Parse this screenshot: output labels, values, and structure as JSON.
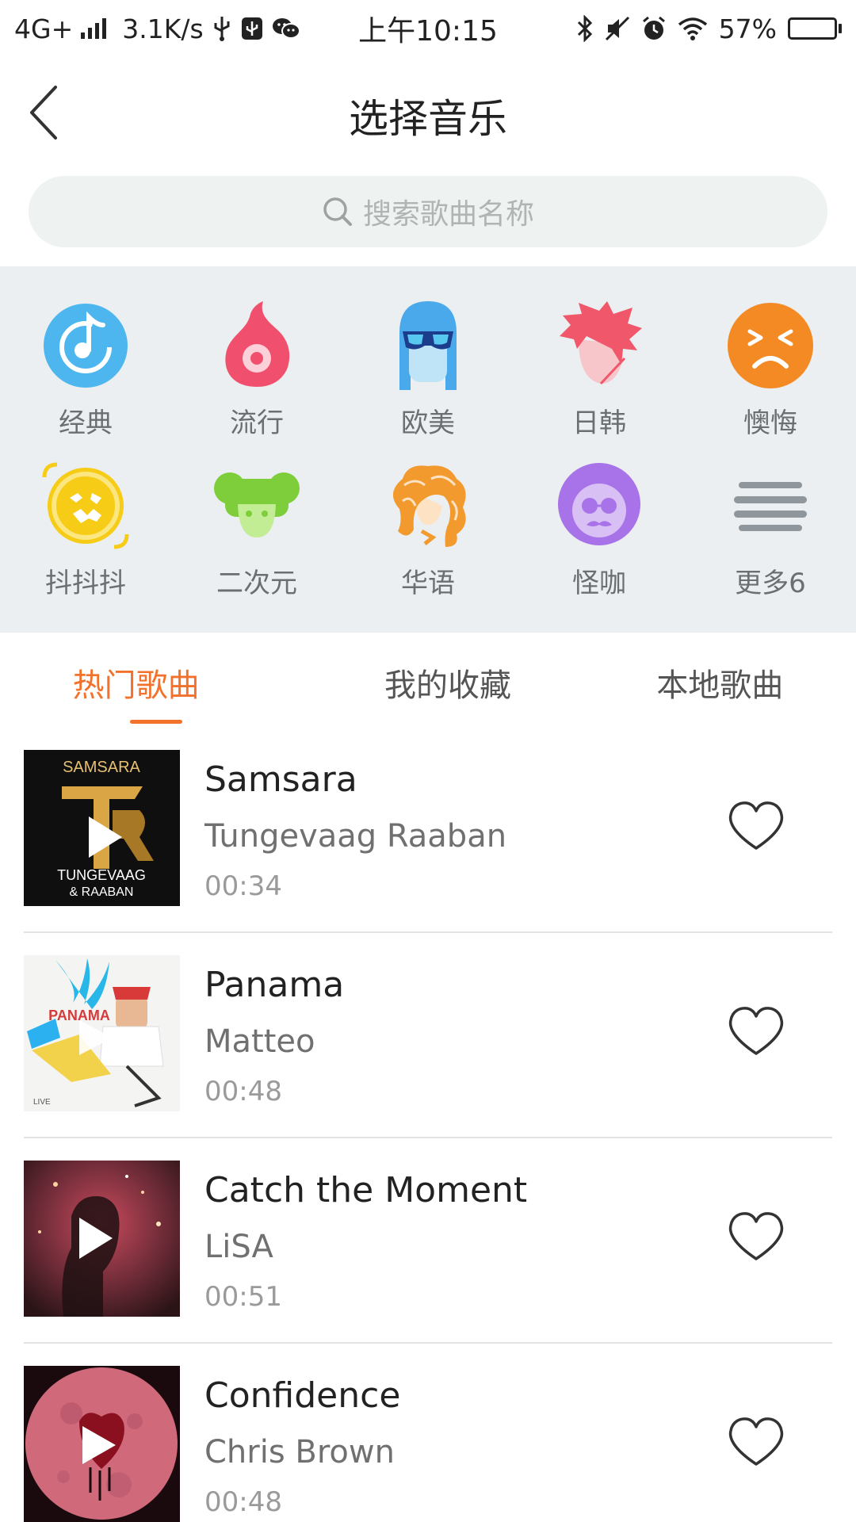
{
  "status_bar": {
    "network": "4G+",
    "speed": "3.1K/s",
    "time": "上午10:15",
    "battery": "57%",
    "battery_level": 0.57
  },
  "header": {
    "title": "选择音乐"
  },
  "search": {
    "placeholder": "搜索歌曲名称"
  },
  "categories": [
    {
      "label": "经典",
      "icon": "note-disc-icon",
      "color": "#4db6ef"
    },
    {
      "label": "流行",
      "icon": "flame-icon",
      "color": "#f0506e"
    },
    {
      "label": "欧美",
      "icon": "sunglasses-face-icon",
      "color": "#4aa9ea"
    },
    {
      "label": "日韩",
      "icon": "anime-hair-icon",
      "color": "#f1576a"
    },
    {
      "label": "懊悔",
      "icon": "sad-face-icon",
      "color": "#f38a24"
    },
    {
      "label": "抖抖抖",
      "icon": "shaky-face-icon",
      "color": "#f6cc16"
    },
    {
      "label": "二次元",
      "icon": "cartoon-head-icon",
      "color": "#7dce3a"
    },
    {
      "label": "华语",
      "icon": "wavy-hair-icon",
      "color": "#f29a2e"
    },
    {
      "label": "怪咖",
      "icon": "mustache-face-icon",
      "color": "#a872e8"
    },
    {
      "label": "更多6",
      "icon": "more-lines-icon",
      "color": "#8f979c"
    }
  ],
  "tabs": [
    {
      "label": "热门歌曲",
      "active": true
    },
    {
      "label": "我的收藏",
      "active": false
    },
    {
      "label": "本地歌曲",
      "active": false
    }
  ],
  "songs": [
    {
      "title": "Samsara",
      "artist": "Tungevaag Raaban",
      "duration": "00:34",
      "cover_text_top": "SAMSARA",
      "cover_text_bottom": "TUNGEVAAG",
      "cover_text_bottom2": "& RAABAN"
    },
    {
      "title": "Panama",
      "artist": "Matteo",
      "duration": "00:48",
      "cover_text": "PANAMA"
    },
    {
      "title": "Catch the Moment",
      "artist": "LiSA",
      "duration": "00:51"
    },
    {
      "title": "Confidence",
      "artist": "Chris Brown",
      "duration": "00:48"
    }
  ],
  "colors": {
    "accent": "#f2722b",
    "category_bg": "#eceff1",
    "search_bg": "#eef2f0"
  }
}
